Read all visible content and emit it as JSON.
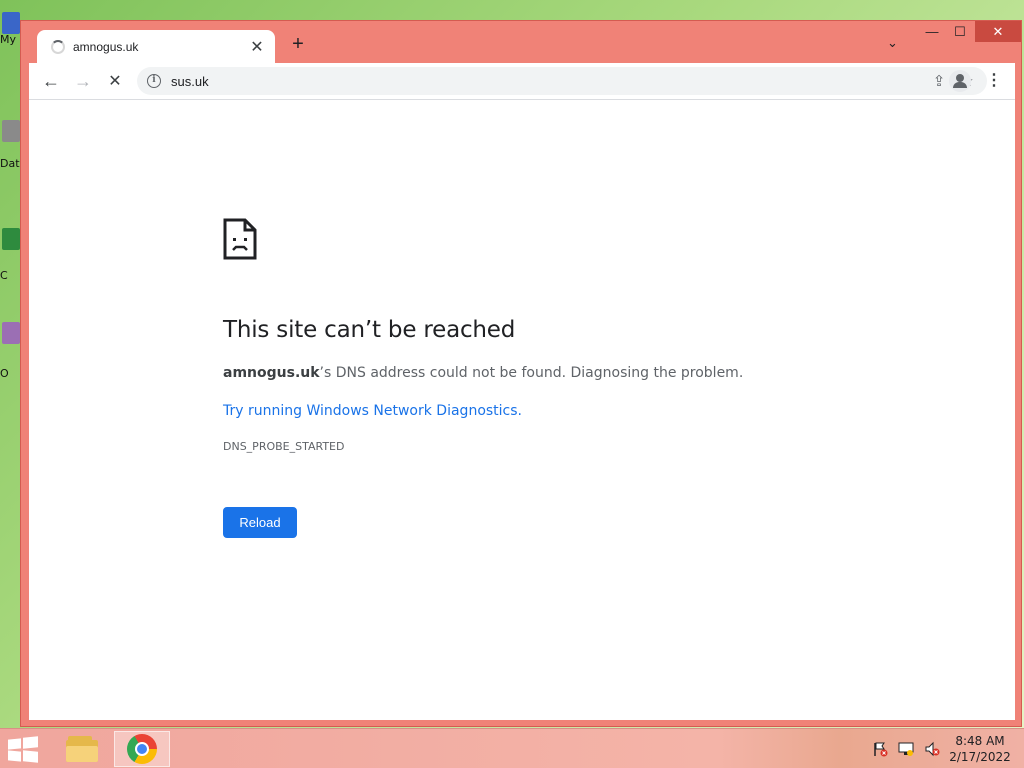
{
  "desktop": {
    "icons": [
      {
        "label": "My",
        "color": "#3a66c8"
      },
      {
        "label": "Dat",
        "color": "#8a8a8a"
      },
      {
        "label": "C",
        "color": "#2e8b3e"
      },
      {
        "label": "O",
        "color": "#9b6fb4"
      }
    ]
  },
  "browser": {
    "tab": {
      "title": "amnogus.uk",
      "close_glyph": "✕"
    },
    "newtab_glyph": "+",
    "tab_menu_glyph": "⌄",
    "window_controls": {
      "minimize": "—",
      "maximize": "☐",
      "close": "✕"
    },
    "nav": {
      "back": "←",
      "forward": "→",
      "stop": "✕"
    },
    "omnibox": {
      "info_glyph": "i",
      "url": "sus.uk"
    },
    "share_glyph": "⇪",
    "bookmark_glyph": "☆",
    "menu_glyph": "⋮"
  },
  "error_page": {
    "title": "This site can’t be reached",
    "domain": "amnogus.uk",
    "description_suffix": "’s DNS address could not be found. Diagnosing the problem.",
    "link": "Try running Windows Network Diagnostics.",
    "error_code": "DNS_PROBE_STARTED",
    "reload_label": "Reload"
  },
  "taskbar": {
    "tray_icons": [
      "flag-icon",
      "network-icon",
      "volume-muted-icon"
    ],
    "time": "8:48 AM",
    "date": "2/17/2022"
  },
  "colors": {
    "window_frame": "#f08277",
    "accent": "#1a73e8"
  }
}
